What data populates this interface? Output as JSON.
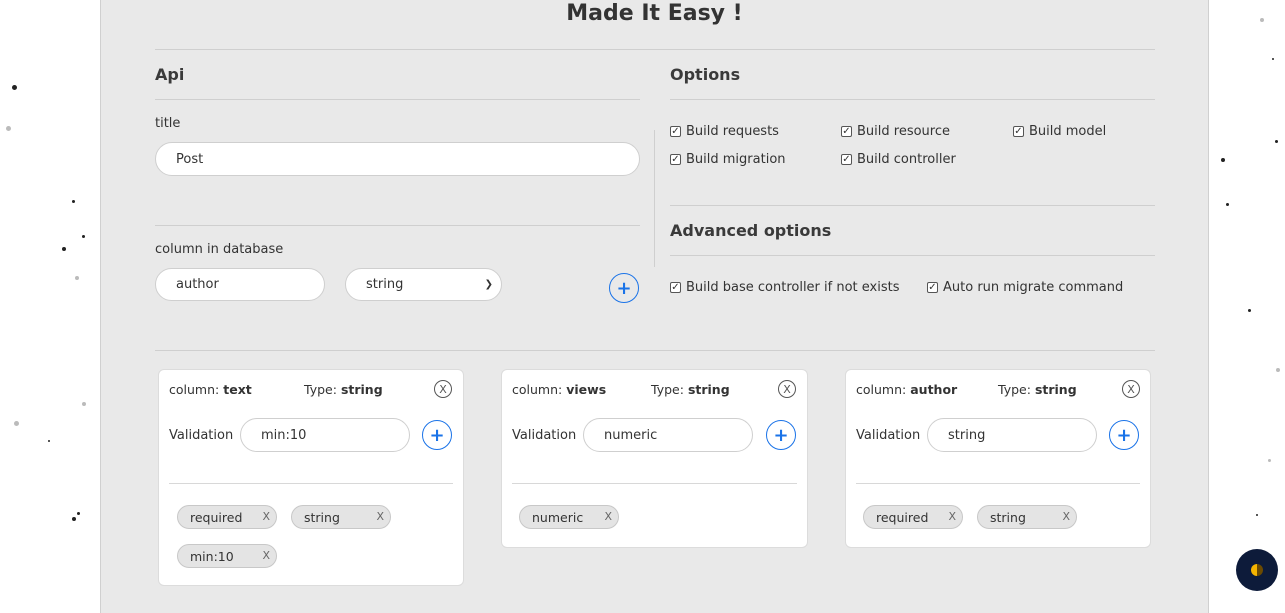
{
  "header": {
    "title": "Made It Easy !"
  },
  "api": {
    "heading": "Api",
    "title_label": "title",
    "title_value": "Post",
    "column_label": "column in database",
    "column_value": "author",
    "type_value": "string"
  },
  "options": {
    "heading": "Options",
    "items": [
      "Build requests",
      "Build resource",
      "Build model",
      "Build migration",
      "Build controller"
    ],
    "advanced_heading": "Advanced options",
    "advanced_items": [
      "Build base controller if not exists",
      "Auto run migrate command"
    ]
  },
  "cards": [
    {
      "column_label": "column:",
      "column_name": "text",
      "type_label": "Type:",
      "type_name": "string",
      "close": "X",
      "validation_label": "Validation",
      "validation_value": "min:10",
      "chips": [
        "required",
        "string",
        "min:10"
      ]
    },
    {
      "column_label": "column:",
      "column_name": "views",
      "type_label": "Type:",
      "type_name": "string",
      "close": "X",
      "validation_label": "Validation",
      "validation_value": "numeric",
      "chips": [
        "numeric"
      ]
    },
    {
      "column_label": "column:",
      "column_name": "author",
      "type_label": "Type:",
      "type_name": "string",
      "close": "X",
      "validation_label": "Validation",
      "validation_value": "string",
      "chips": [
        "required",
        "string"
      ]
    }
  ],
  "chip_remove": "X",
  "icons": {
    "add": "plus-icon",
    "remove": "close-icon",
    "theme": "moon-icon",
    "dropdown": "chevron-down-icon",
    "check": "checkmark-icon"
  },
  "colors": {
    "accent": "#1a73e8",
    "panel": "#e9e9e9",
    "theme_button": "#0d1b3a"
  }
}
